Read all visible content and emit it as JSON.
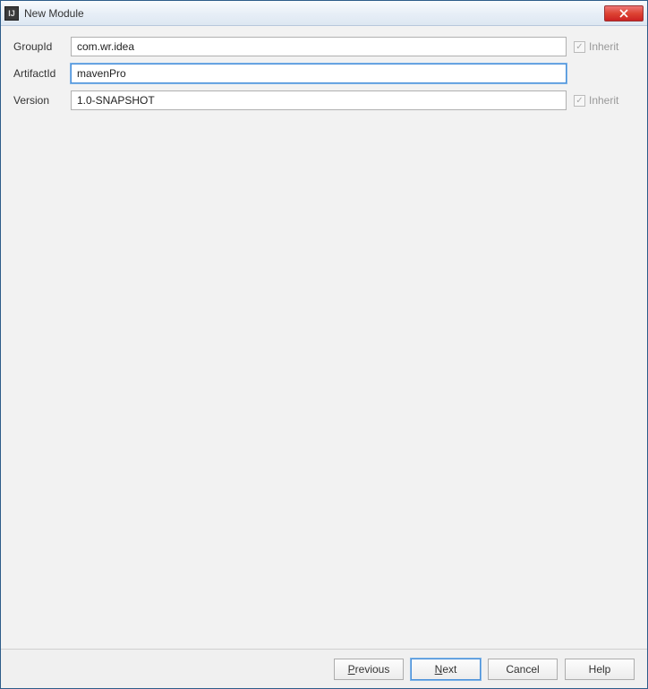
{
  "window": {
    "title": "New Module"
  },
  "form": {
    "groupIdLabel": "GroupId",
    "groupIdValue": "com.wr.idea",
    "artifactIdLabel": "ArtifactId",
    "artifactIdValue": "mavenPro",
    "versionLabel": "Version",
    "versionValue": "1.0-SNAPSHOT",
    "inheritLabel": "Inherit",
    "groupIdInheritChecked": true,
    "versionInheritChecked": true
  },
  "buttons": {
    "previous": "Previous",
    "next": "Next",
    "cancel": "Cancel",
    "help": "Help"
  }
}
